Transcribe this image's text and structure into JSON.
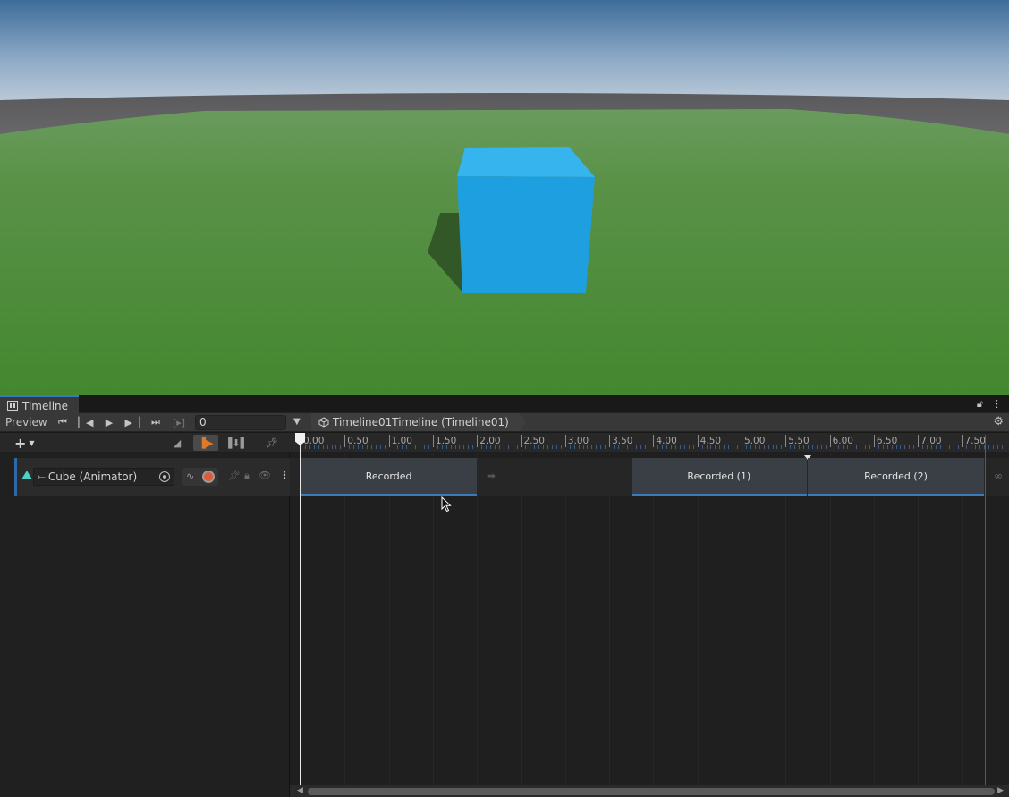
{
  "timeline_window": {
    "tab_title": "Timeline",
    "preview_label": "Preview",
    "frame_value": "0",
    "breadcrumb": "Timeline01Timeline (Timeline01)"
  },
  "ruler": {
    "labels": [
      "0.00",
      "0.50",
      "1.00",
      "1.50",
      "2.00",
      "2.50",
      "3.00",
      "3.50",
      "4.00",
      "4.50",
      "5.00",
      "5.50",
      "6.00",
      "6.50",
      "7.00",
      "7.50"
    ]
  },
  "track": {
    "binding_label": "Cube (Animator)",
    "clips": [
      {
        "label": "Recorded",
        "start": 0.0,
        "end": 2.0
      },
      {
        "label": "Recorded (1)",
        "start": 3.75,
        "end": 5.75
      },
      {
        "label": "Recorded (2)",
        "start": 5.75,
        "end": 7.75
      }
    ]
  },
  "playhead_time": 0.0,
  "colors": {
    "accent": "#3a79bb",
    "record": "#e05a3a",
    "animator_icon": "#4dd2c2",
    "cube": "#1e9fdf",
    "ground": "#4b8a35"
  },
  "icons": {
    "transport": [
      "skip-to-start-icon",
      "previous-frame-icon",
      "play-icon",
      "next-frame-icon",
      "skip-to-end-icon",
      "play-range-icon"
    ]
  }
}
